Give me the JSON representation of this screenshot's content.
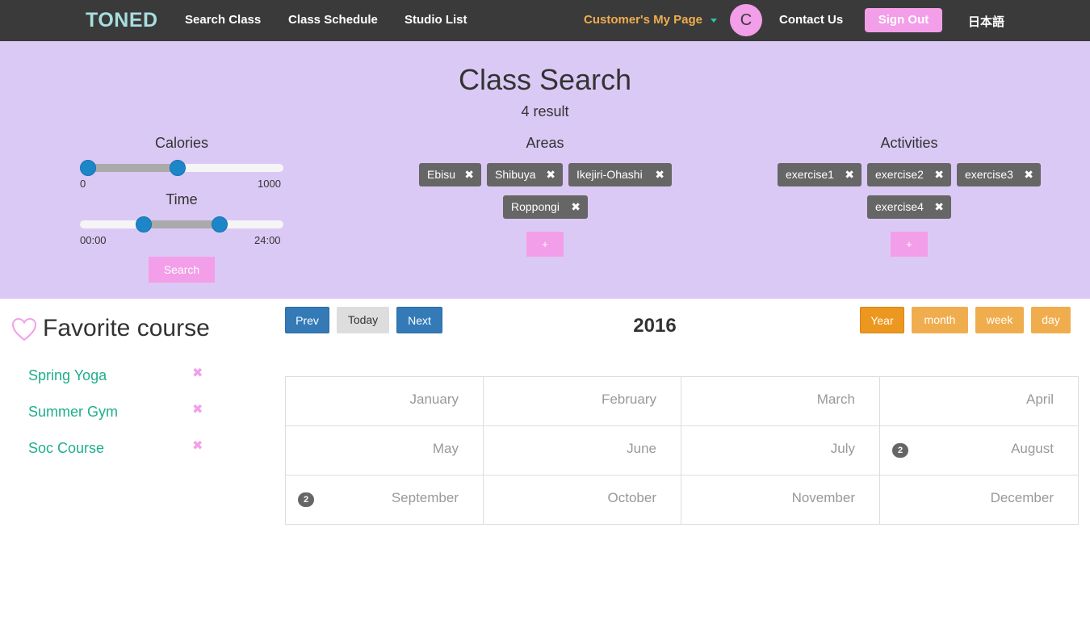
{
  "navbar": {
    "brand": "TONED",
    "links": [
      "Search Class",
      "Class Schedule",
      "Studio List"
    ],
    "my_page": "Customer's My Page",
    "avatar_initial": "C",
    "contact": "Contact Us",
    "sign_out": "Sign Out",
    "language": "日本語"
  },
  "search": {
    "title": "Class Search",
    "result_count": "4 result",
    "calories": {
      "label": "Calories",
      "min_label": "0",
      "max_label": "1000",
      "min": 0,
      "max": 1000,
      "low": 0,
      "high": 460
    },
    "time": {
      "label": "Time",
      "min_label": "00:00",
      "max_label": "24:00",
      "low": 0.32,
      "high": 0.7
    },
    "search_button": "Search",
    "areas": {
      "label": "Areas",
      "tags": [
        "Ebisu",
        "Shibuya",
        "Ikejiri-Ohashi",
        "Roppongi"
      ],
      "add_label": "+"
    },
    "activities": {
      "label": "Activities",
      "tags": [
        "exercise1",
        "exercise2",
        "exercise3",
        "exercise4"
      ],
      "add_label": "+"
    },
    "remove_glyph": "✖"
  },
  "favorites": {
    "title": "Favorite course",
    "items": [
      "Spring Yoga",
      "Summer Gym",
      "Soc Course"
    ],
    "remove_glyph": "✖"
  },
  "calendar": {
    "prev": "Prev",
    "today": "Today",
    "next": "Next",
    "year": "2016",
    "views": [
      "Year",
      "month",
      "week",
      "day"
    ],
    "active_view": "Year",
    "months": [
      "January",
      "February",
      "March",
      "April",
      "May",
      "June",
      "July",
      "August",
      "September",
      "October",
      "November",
      "December"
    ],
    "event_counts": {
      "August": "2",
      "September": "2"
    }
  },
  "colors": {
    "navbar_bg": "#3a3a3a",
    "panel_bg": "#dbc9f5",
    "accent_pink": "#f39ee8",
    "accent_orange": "#f0ad4e",
    "link_green": "#1fae8c",
    "primary_blue": "#337ab7"
  }
}
